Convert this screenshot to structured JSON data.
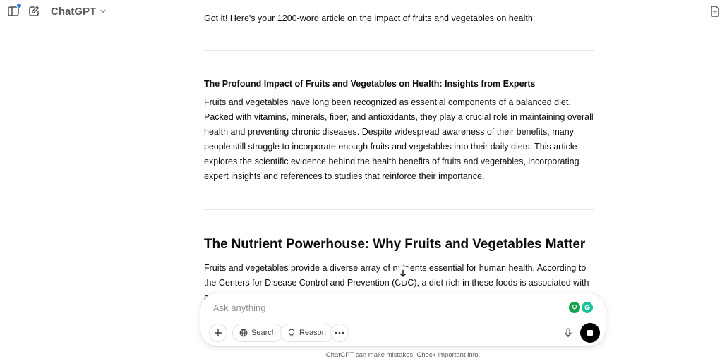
{
  "header": {
    "model_name": "ChatGPT",
    "icons": [
      "sidebar-toggle-icon",
      "new-chat-icon",
      "chevron-down-icon",
      "notes-icon"
    ],
    "notification_color": "#2b7bf2"
  },
  "message": {
    "intro": "Got it! Here's your 1200-word article on the impact of fruits and vegetables on health:",
    "article_title": "The Profound Impact of Fruits and Vegetables on Health: Insights from Experts",
    "paragraph_1": "Fruits and vegetables have long been recognized as essential components of a balanced diet. Packed with vitamins, minerals, fiber, and antioxidants, they play a crucial role in maintaining overall health and preventing chronic diseases. Despite widespread awareness of their benefits, many people still struggle to incorporate enough fruits and vegetables into their daily diets. This article explores the scientific evidence behind the health benefits of fruits and vegetables, incorporating expert insights and references to studies that reinforce their importance.",
    "section_heading": "The Nutrient Powerhouse: Why Fruits and Vegetables Matter",
    "paragraph_2": "Fruits and vegetables provide a diverse array of nutrients essential for human health. According to the Centers for Disease Control and Prevention (CDC), a diet rich in these foods is associated with a reduced risk of many chronic diseases."
  },
  "composer": {
    "placeholder": "Ask anything",
    "search_label": "Search",
    "reason_label": "Reason",
    "icons": [
      "plus-icon",
      "globe-icon",
      "lightbulb-icon",
      "more-icon",
      "microphone-icon",
      "stop-icon",
      "scroll-down-arrow-icon"
    ],
    "extension_colors": [
      "#15a04a",
      "#15c39a"
    ]
  },
  "footer": {
    "disclaimer": "ChatGPT can make mistakes. Check important info."
  }
}
